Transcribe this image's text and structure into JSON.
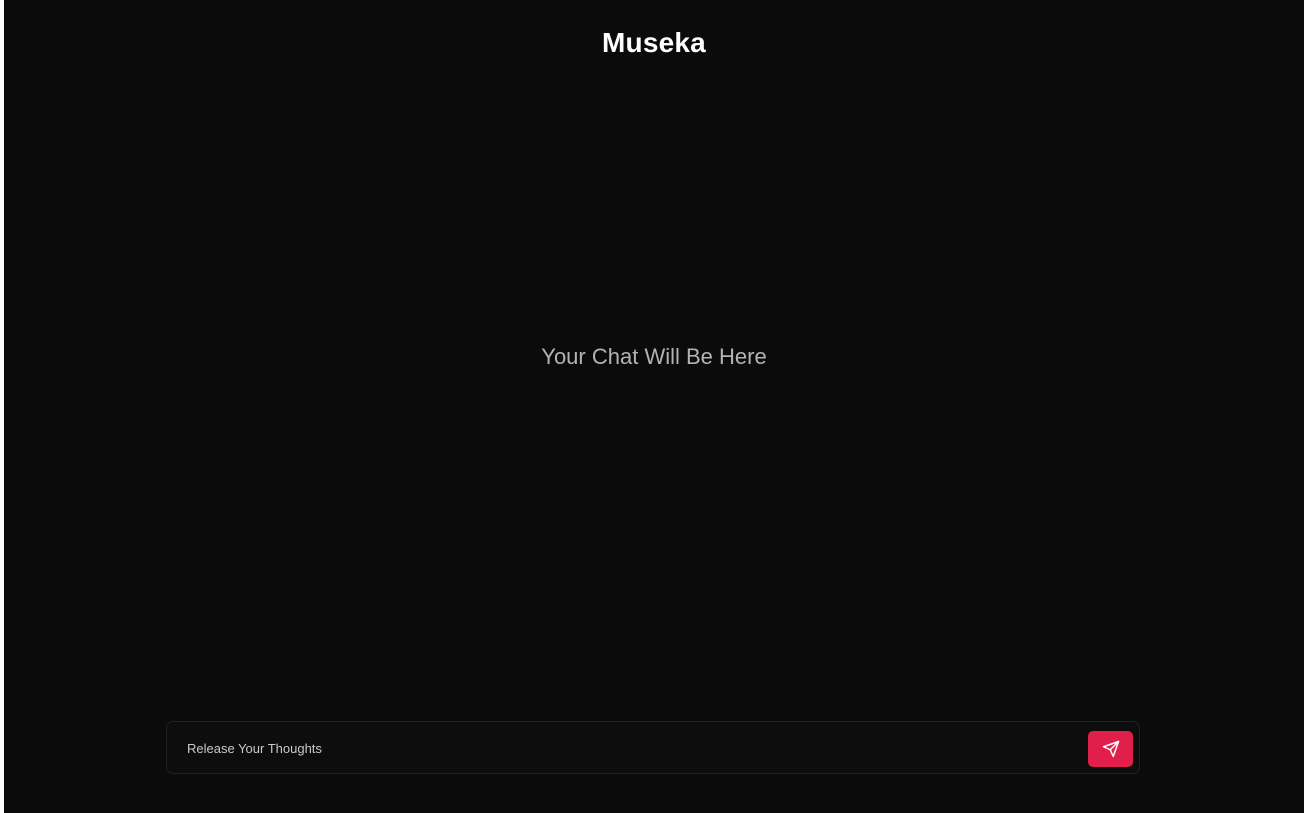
{
  "app": {
    "title": "Museka"
  },
  "chat": {
    "empty_message": "Your Chat Will Be Here"
  },
  "composer": {
    "input_value": "",
    "placeholder": "Release Your Thoughts",
    "send_icon": "send-icon"
  },
  "colors": {
    "background": "#0c0b0b",
    "accent": "#e0204a",
    "title_text": "#ffffff",
    "muted_text": "#b3b3b3"
  }
}
